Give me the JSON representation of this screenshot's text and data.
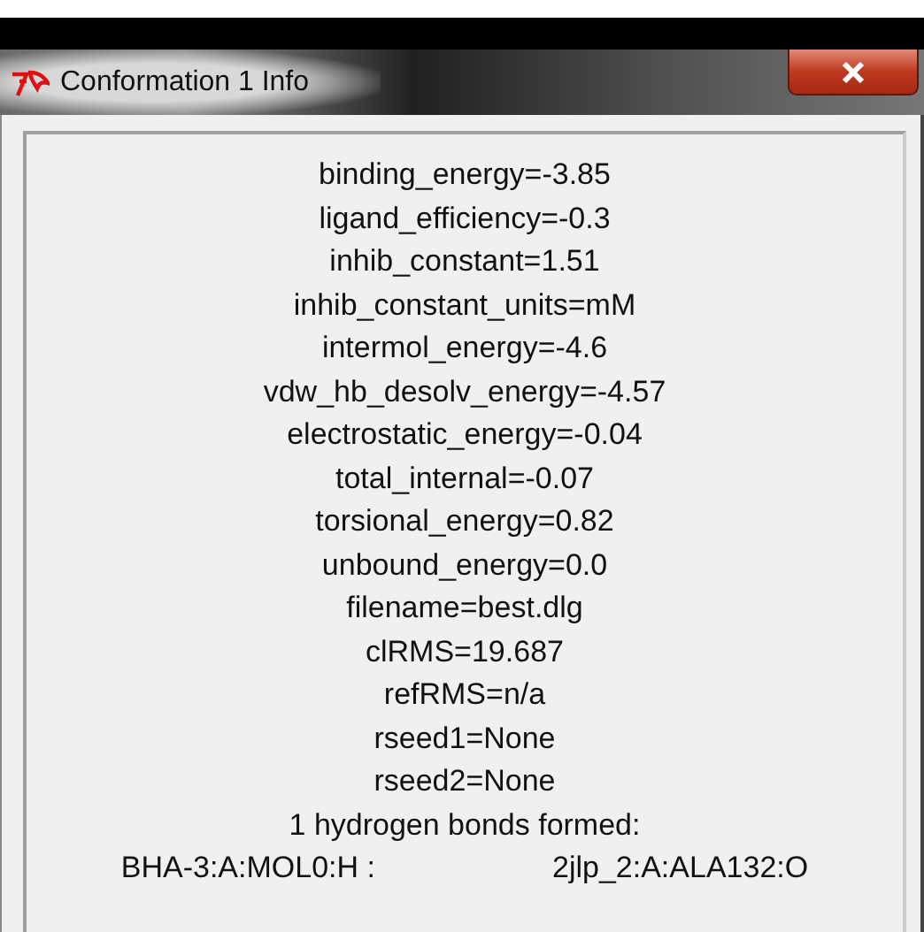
{
  "window": {
    "title": "Conformation 1 Info"
  },
  "lines": [
    {
      "kind": "text",
      "text": "binding_energy=-3.85"
    },
    {
      "kind": "text",
      "text": "ligand_efficiency=-0.3"
    },
    {
      "kind": "text",
      "text": "inhib_constant=1.51"
    },
    {
      "kind": "text",
      "text": "inhib_constant_units=mM"
    },
    {
      "kind": "text",
      "text": "intermol_energy=-4.6"
    },
    {
      "kind": "text",
      "text": "vdw_hb_desolv_energy=-4.57"
    },
    {
      "kind": "text",
      "text": "electrostatic_energy=-0.04"
    },
    {
      "kind": "text",
      "text": "total_internal=-0.07"
    },
    {
      "kind": "text",
      "text": "torsional_energy=0.82"
    },
    {
      "kind": "text",
      "text": "unbound_energy=0.0"
    },
    {
      "kind": "text",
      "text": "filename=best.dlg"
    },
    {
      "kind": "text",
      "text": "clRMS=19.687"
    },
    {
      "kind": "text",
      "text": "refRMS=n/a"
    },
    {
      "kind": "text",
      "text": "rseed1=None"
    },
    {
      "kind": "text",
      "text": "rseed2=None"
    },
    {
      "kind": "text",
      "text": "1 hydrogen bonds formed:"
    },
    {
      "kind": "bond",
      "donor": "BHA-3:A:MOL0:H :",
      "acceptor": "2jlp_2:A:ALA132:O"
    }
  ]
}
